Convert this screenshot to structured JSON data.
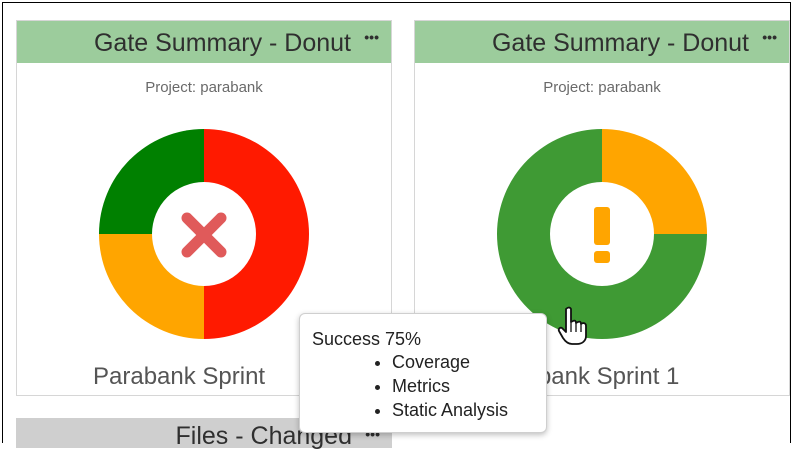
{
  "widgets": [
    {
      "title": "Gate Summary - Donut",
      "menu_icon": "ellipsis-icon",
      "project": "Project: parabank",
      "build_name": "Parabank Sprint",
      "status_icon": "error-x-icon",
      "segments": [
        {
          "label": "Failure",
          "color": "#ff1a00",
          "value": 50
        },
        {
          "label": "Warning",
          "color": "#ffa500",
          "value": 25
        },
        {
          "label": "Success",
          "color": "#008000",
          "value": 25
        }
      ]
    },
    {
      "title": "Gate Summary - Donut",
      "menu_icon": "ellipsis-icon",
      "project": "Project: parabank",
      "build_name": "abank Sprint 1",
      "status_icon": "warning-exclamation-icon",
      "segments": [
        {
          "label": "Warning",
          "color": "#ffa500",
          "value": 25
        },
        {
          "label": "Success",
          "color": "#3f9a34",
          "value": 75
        }
      ]
    }
  ],
  "bottom_widget": {
    "title": "Files - Changed",
    "menu_icon": "ellipsis-icon"
  },
  "tooltip": {
    "title": "Success 75%",
    "items": [
      "Coverage",
      "Metrics",
      "Static Analysis"
    ]
  },
  "colors": {
    "header_bg": "#9ccc9c",
    "bottom_header_bg": "#cfcfcf",
    "error_icon": "#e05a5a",
    "warning_icon": "#ffa500"
  }
}
